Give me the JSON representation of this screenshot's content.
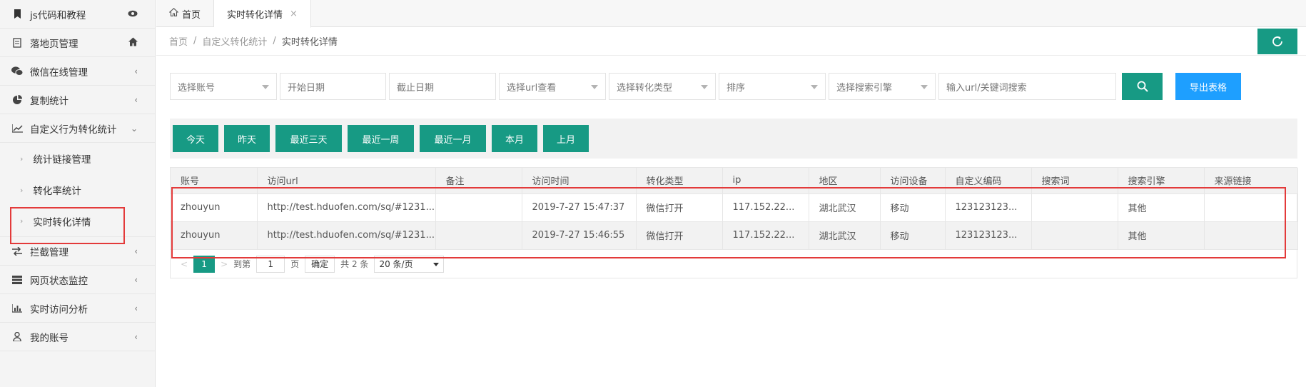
{
  "sidebar": {
    "items": [
      {
        "label": "js代码和教程",
        "icon": "bookmark-icon",
        "right": "eye-icon"
      },
      {
        "label": "落地页管理",
        "icon": "document-icon",
        "right": "home-icon"
      },
      {
        "label": "微信在线管理",
        "icon": "wechat-icon",
        "right": "chevron-left-icon"
      },
      {
        "label": "复制统计",
        "icon": "pie-chart-icon",
        "right": "chevron-left-icon"
      },
      {
        "label": "自定义行为转化统计",
        "icon": "line-chart-icon",
        "right": "chevron-down-icon"
      }
    ],
    "sub_items": [
      {
        "label": "统计链接管理"
      },
      {
        "label": "转化率统计"
      },
      {
        "label": "实时转化详情"
      }
    ],
    "items_after": [
      {
        "label": "拦截管理",
        "icon": "exchange-icon",
        "right": "chevron-left-icon"
      },
      {
        "label": "网页状态监控",
        "icon": "server-icon",
        "right": "chevron-left-icon"
      },
      {
        "label": "实时访问分析",
        "icon": "bar-chart-icon",
        "right": "chevron-left-icon"
      },
      {
        "label": "我的账号",
        "icon": "user-icon",
        "right": "chevron-left-icon"
      }
    ]
  },
  "tabs": [
    {
      "label": "首页",
      "icon": "home-icon"
    },
    {
      "label": "实时转化详情",
      "close": "×"
    }
  ],
  "breadcrumb": [
    "首页",
    "自定义转化统计",
    "实时转化详情"
  ],
  "breadcrumb_sep": "/",
  "filters": {
    "account_placeholder": "选择账号",
    "start_date_placeholder": "开始日期",
    "end_date_placeholder": "截止日期",
    "url_placeholder": "选择url查看",
    "type_placeholder": "选择转化类型",
    "sort_placeholder": "排序",
    "engine_placeholder": "选择搜索引擎",
    "keyword_placeholder": "输入url/关键词搜索",
    "export_label": "导出表格"
  },
  "ranges": [
    "今天",
    "昨天",
    "最近三天",
    "最近一周",
    "最近一月",
    "本月",
    "上月"
  ],
  "table": {
    "columns": [
      "账号",
      "访问url",
      "备注",
      "访问时间",
      "转化类型",
      "ip",
      "地区",
      "访问设备",
      "自定义编码",
      "搜索词",
      "搜索引擎",
      "来源链接"
    ],
    "rows": [
      [
        "zhouyun",
        "http://test.hduofen.com/sq/#1231...",
        "",
        "2019-7-27 15:47:37",
        "微信打开",
        "117.152.22...",
        "湖北武汉",
        "移动",
        "123123123...",
        "",
        "其他",
        ""
      ],
      [
        "zhouyun",
        "http://test.hduofen.com/sq/#1231...",
        "",
        "2019-7-27 15:46:55",
        "微信打开",
        "117.152.22...",
        "湖北武汉",
        "移动",
        "123123123...",
        "",
        "其他",
        ""
      ]
    ]
  },
  "pager": {
    "prev": "<",
    "current": "1",
    "next": ">",
    "goto_label": "到第",
    "goto_value": "1",
    "page_unit": "页",
    "ok_label": "确定",
    "total": "共 2 条",
    "page_size": "20 条/页"
  },
  "colors": {
    "primary": "#179a84",
    "export": "#1e9fff",
    "highlight": "#e33a3a"
  }
}
